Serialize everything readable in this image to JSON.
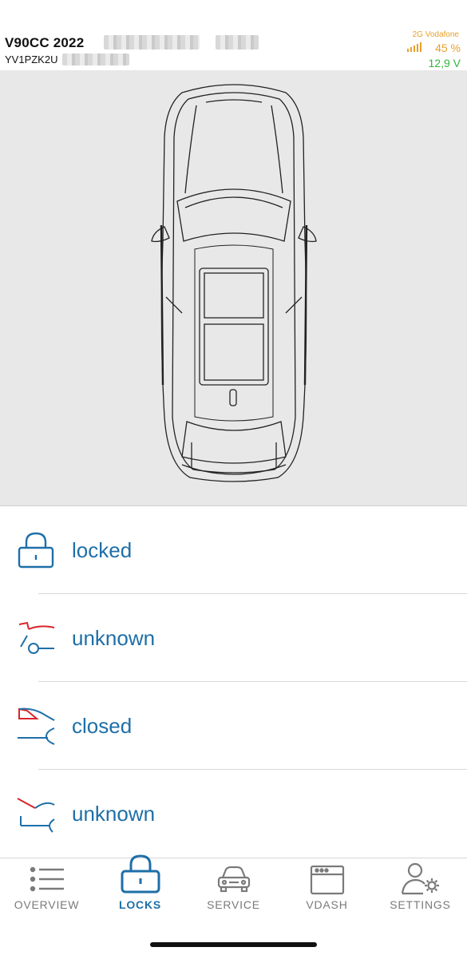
{
  "header": {
    "vehicle_title": "V90CC 2022",
    "vin_prefix": "YV1PZK2U",
    "carrier": "2G Vodafone",
    "battery_percent": "45 %",
    "voltage": "12,9 V",
    "colors": {
      "carrier": "#e8a02a",
      "voltage": "#2fb53a"
    }
  },
  "car_view": {
    "icon": "car-top-view-icon"
  },
  "status_items": [
    {
      "label": "locked",
      "icon": "lock-icon"
    },
    {
      "label": "unknown",
      "icon": "rear-door-icon"
    },
    {
      "label": "closed",
      "icon": "front-door-icon"
    },
    {
      "label": "unknown",
      "icon": "hood-icon"
    }
  ],
  "tabs": [
    {
      "label": "OVERVIEW",
      "icon": "list-icon",
      "active": false
    },
    {
      "label": "LOCKS",
      "icon": "lock-icon",
      "active": true
    },
    {
      "label": "SERVICE",
      "icon": "car-icon",
      "active": false
    },
    {
      "label": "VDASH",
      "icon": "dashboard-window-icon",
      "active": false
    },
    {
      "label": "SETTINGS",
      "icon": "user-settings-icon",
      "active": false
    }
  ],
  "colors": {
    "accent": "#1e6fa8",
    "alert": "#d8242b",
    "tab_inactive": "#7a7a7a"
  }
}
